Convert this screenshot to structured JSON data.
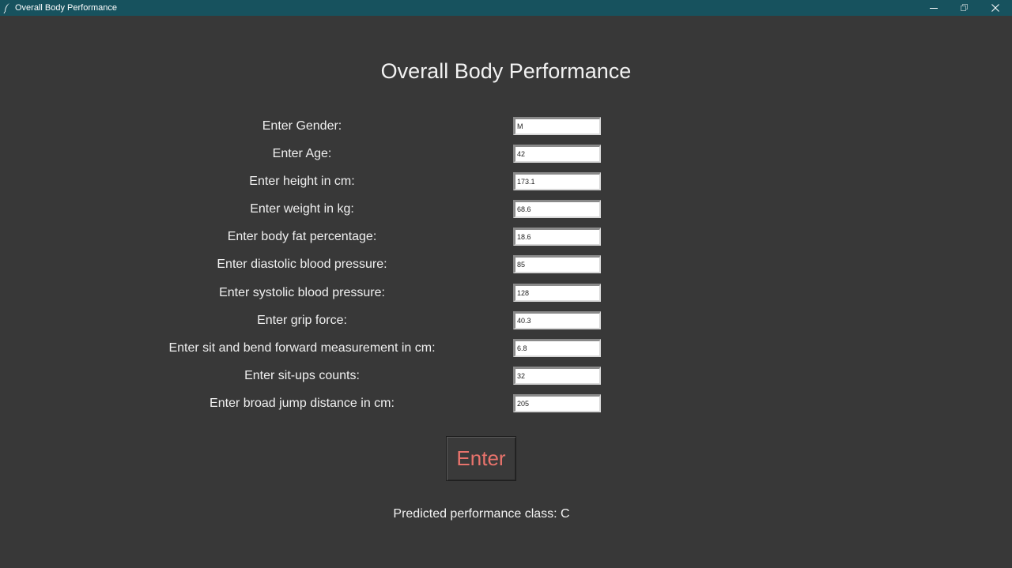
{
  "window": {
    "title": "Overall Body Performance",
    "titlebar_color": "#17525e",
    "background_color": "#383838",
    "controls": [
      "minimize-icon",
      "maximize-icon",
      "close-icon"
    ]
  },
  "main": {
    "heading": "Overall Body Performance",
    "fields": [
      {
        "label": "Enter Gender:",
        "value": "M"
      },
      {
        "label": "Enter Age:",
        "value": "42"
      },
      {
        "label": "Enter height in cm:",
        "value": "173.1"
      },
      {
        "label": "Enter weight in kg:",
        "value": "68.6"
      },
      {
        "label": "Enter body fat percentage:",
        "value": "18.6"
      },
      {
        "label": "Enter diastolic blood pressure:",
        "value": "85"
      },
      {
        "label": "Enter systolic blood pressure:",
        "value": "128"
      },
      {
        "label": "Enter grip force:",
        "value": "40.3"
      },
      {
        "label": "Enter sit and bend forward measurement in cm:",
        "value": "6.8"
      },
      {
        "label": "Enter sit-ups counts:",
        "value": "32"
      },
      {
        "label": "Enter broad jump distance in cm:",
        "value": "205"
      }
    ],
    "enter_button_label": "Enter",
    "enter_button_color": "#e8736c",
    "result_text": "Predicted performance class: C"
  }
}
